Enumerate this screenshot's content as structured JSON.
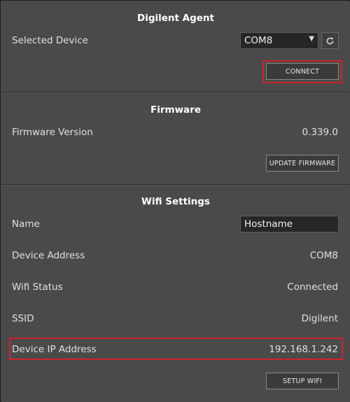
{
  "agent": {
    "title": "Digilent Agent",
    "selected_device_label": "Selected Device",
    "selected_device_value": "COM8",
    "refresh_icon": "refresh-icon",
    "connect_label": "CONNECT"
  },
  "firmware": {
    "title": "Firmware",
    "version_label": "Firmware Version",
    "version_value": "0.339.0",
    "update_label": "UPDATE FIRMWARE"
  },
  "wifi": {
    "title": "Wifi Settings",
    "name_label": "Name",
    "name_value": "Hostname",
    "device_address_label": "Device Address",
    "device_address_value": "COM8",
    "status_label": "Wifi Status",
    "status_value": "Connected",
    "ssid_label": "SSID",
    "ssid_value": "Digilent",
    "ip_label": "Device IP Address",
    "ip_value": "192.168.1.242",
    "setup_label": "SETUP WIFI"
  },
  "colors": {
    "highlight": "#d1222b",
    "panel": "#4a4a4a",
    "input_bg": "#262626"
  }
}
